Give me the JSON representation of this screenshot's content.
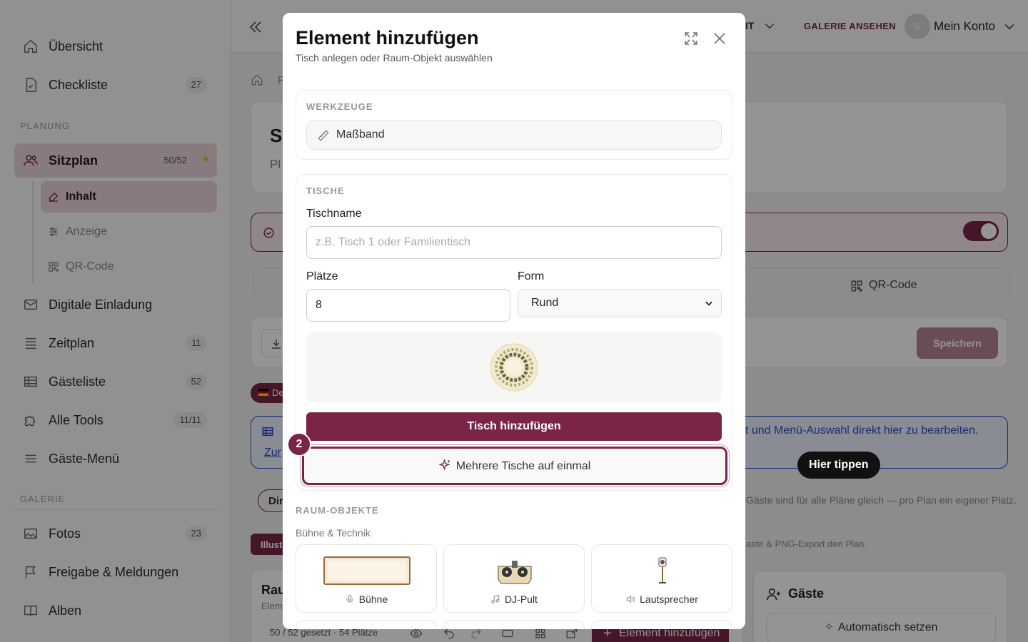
{
  "sidebar": {
    "items_top": [
      {
        "label": "Übersicht",
        "icon": "home-icon"
      },
      {
        "label": "Checkliste",
        "badge": "27",
        "icon": "checklist-icon"
      }
    ],
    "section_planung": "PLANUNG",
    "sitzplan": {
      "label": "Sitzplan",
      "badge": "50/52",
      "star": "★"
    },
    "sub_items": [
      {
        "label": "Inhalt",
        "icon": "edit-icon"
      },
      {
        "label": "Anzeige",
        "icon": "sliders-icon"
      },
      {
        "label": "QR-Code",
        "icon": "qr-code-icon"
      }
    ],
    "items_planung": [
      {
        "label": "Digitale Einladung",
        "icon": "mail-icon"
      },
      {
        "label": "Zeitplan",
        "badge": "11",
        "icon": "timeline-icon"
      },
      {
        "label": "Gästeliste",
        "badge": "52",
        "icon": "table-icon"
      },
      {
        "label": "Alle Tools",
        "badge": "11/11",
        "icon": "puzzle-icon"
      },
      {
        "label": "Gäste-Menü",
        "icon": "menu-icon"
      }
    ],
    "section_galerie": "GALERIE",
    "items_galerie": [
      {
        "label": "Fotos",
        "badge": "23",
        "icon": "image-icon"
      },
      {
        "label": "Freigabe & Meldungen",
        "icon": "flag-icon"
      },
      {
        "label": "Alben",
        "icon": "book-icon"
      }
    ]
  },
  "topbar": {
    "partial_label": "IT",
    "gallery_link": "GALERIE ANSEHEN",
    "avatar_initial": "S",
    "account_label": "Mein Konto"
  },
  "background": {
    "breadcrumb_fragment": "F",
    "title_fragment": "S",
    "subtitle_fragment": "Pl",
    "qr_tab": "QR-Code",
    "save_button": "Speichern",
    "lang_chip": "De",
    "info_text": "t und Menü-Auswahl direkt hier zu bearbeiten.",
    "info_link": "Zur",
    "dir_chip": "Dir",
    "illust_chip": "Illust",
    "note_1": "Gäste sind für alle Pläne gleich — pro Plan ein eigener Platz.",
    "note_2": "aste & PNG-Export den Plan.",
    "rau_title": "Rau",
    "rau_sub": "Elem",
    "guests_title": "Gäste",
    "auto_button": "Automatisch setzen",
    "status_text": "50 / 52 gesetzt · 54 Plätze",
    "add_element_button": "Element hinzufügen"
  },
  "modal": {
    "title": "Element hinzufügen",
    "subtitle": "Tisch anlegen oder Raum-Objekt auswählen",
    "tools_label": "WERKZEUGE",
    "tool_measure": "Maßband",
    "tables_label": "TISCHE",
    "table_name_label": "Tischname",
    "table_name_placeholder": "z.B. Tisch 1 oder Familientisch",
    "seats_label": "Plätze",
    "seats_value": "8",
    "shape_label": "Form",
    "shape_selected": "Rund",
    "add_table_button": "Tisch hinzufügen",
    "multi_button": "Mehrere Tische auf einmal",
    "step_number": "2",
    "room_label": "RAUM-OBJEKTE",
    "room_category": "Bühne & Technik",
    "room_objects": [
      {
        "label": "Bühne",
        "icon": "microphone-icon"
      },
      {
        "label": "DJ-Pult",
        "icon": "music-note-icon"
      },
      {
        "label": "Lautsprecher",
        "icon": "speaker-icon"
      }
    ]
  },
  "tooltip": "Hier tippen",
  "colors": {
    "accent": "#7a2547",
    "active_bg": "#e9d4db",
    "info_blue": "#2a4fc4"
  }
}
